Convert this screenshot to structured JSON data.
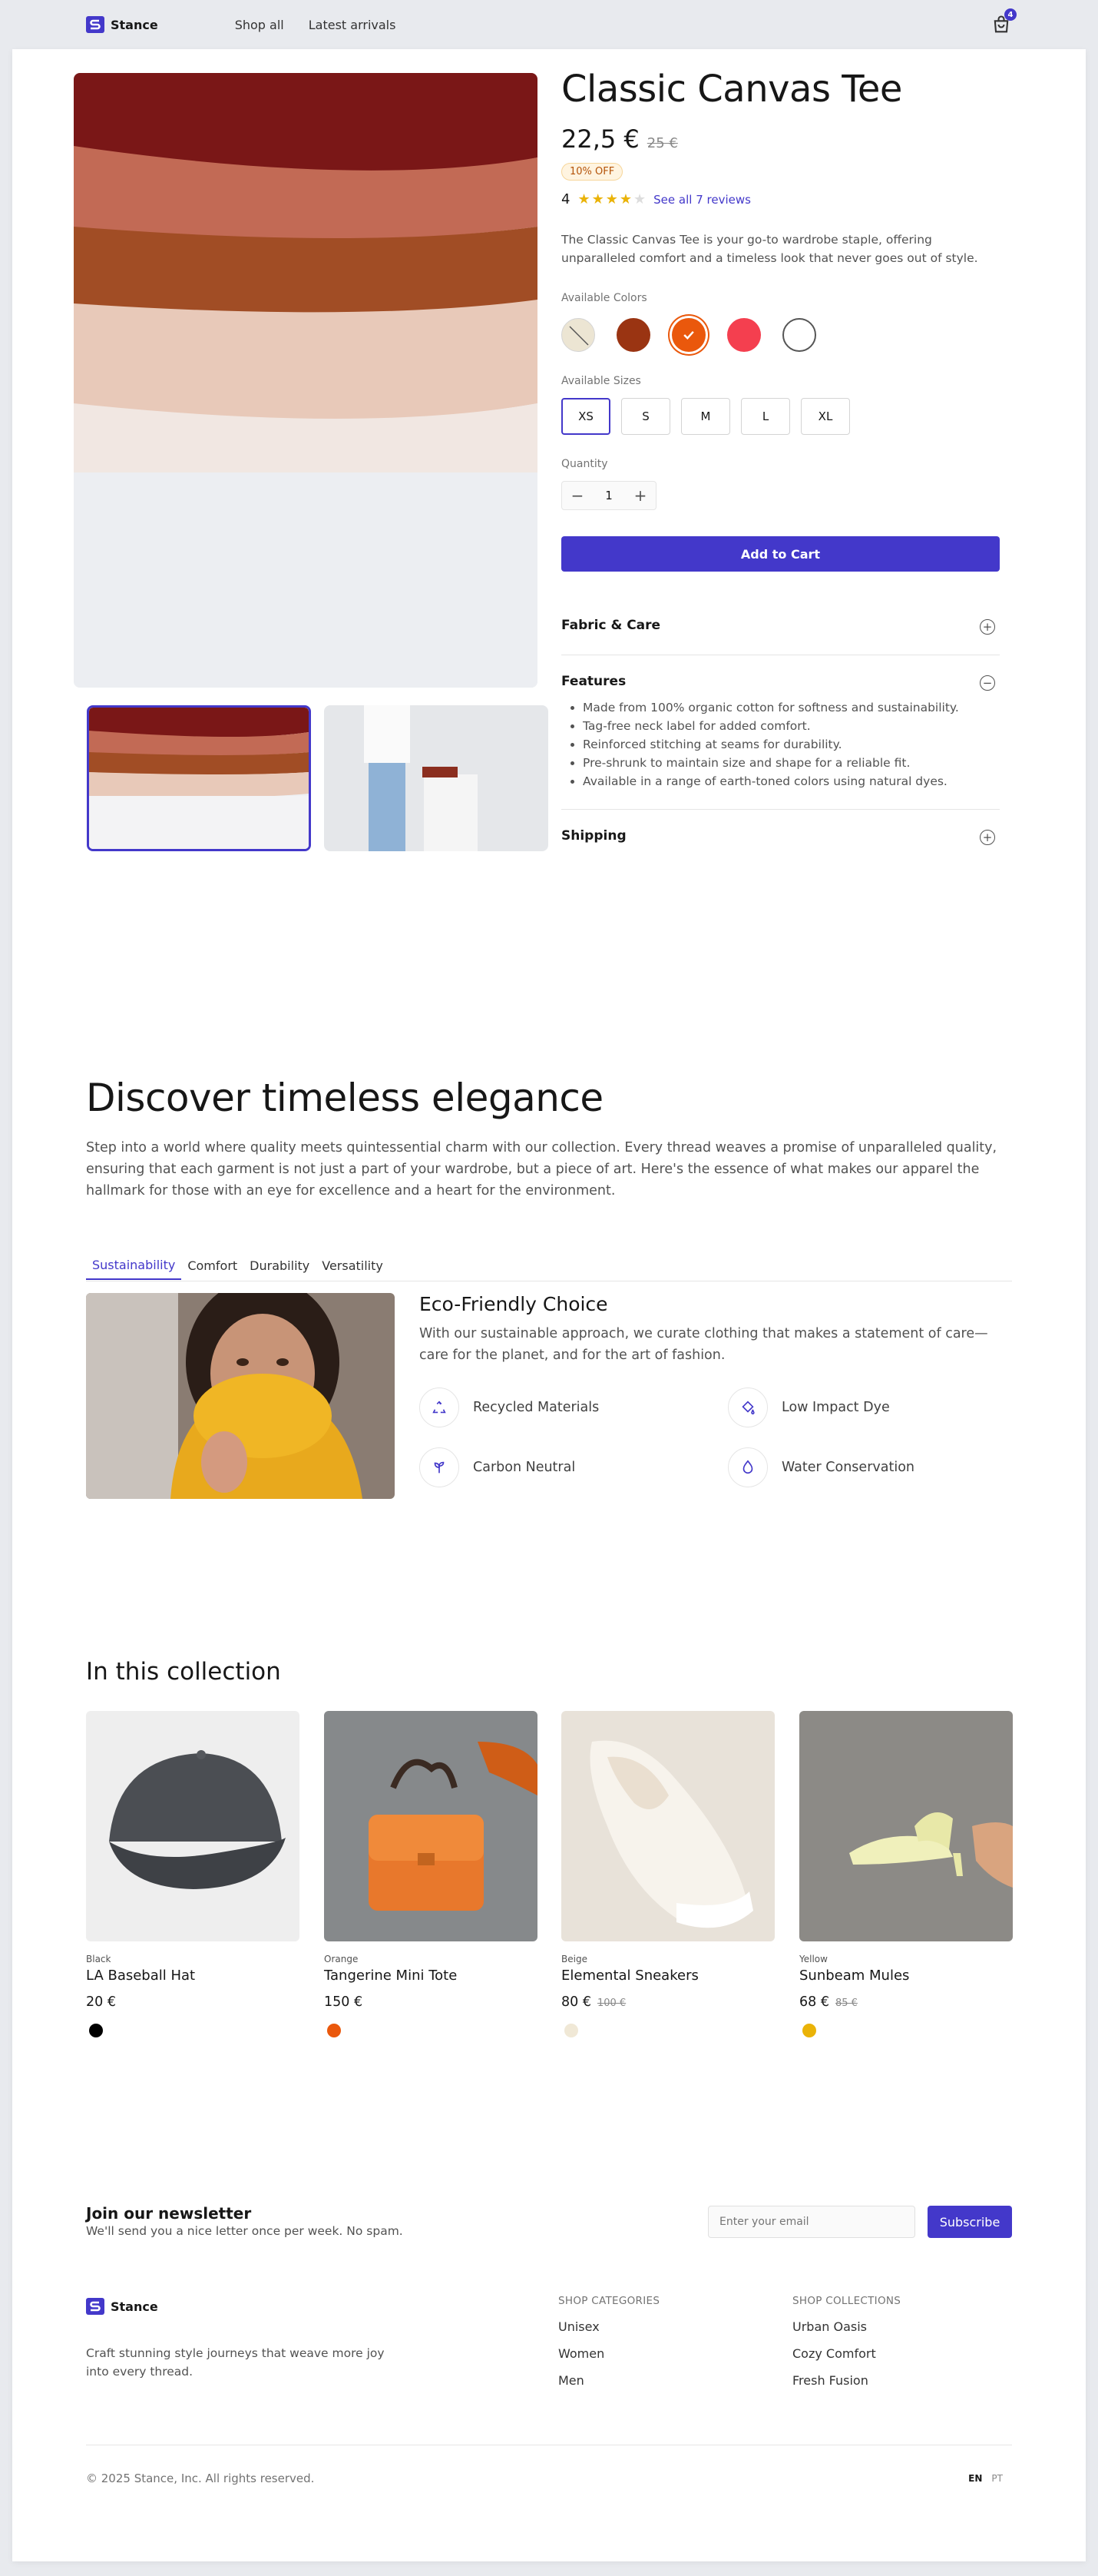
{
  "brand": {
    "name": "Stance",
    "color": "#4338ca"
  },
  "nav": {
    "items": [
      "Shop all",
      "Latest arrivals"
    ]
  },
  "cart": {
    "count": "4"
  },
  "product": {
    "title": "Classic Canvas Tee",
    "price": "22,5 €",
    "old_price": "25 €",
    "discount": "10% OFF",
    "rating": "4",
    "stars": 4,
    "reviews_link": "See all 7 reviews",
    "description": "The Classic Canvas Tee is your go-to wardrobe staple, offering unparalleled comfort and a timeless look that never goes out of style.",
    "colors_label": "Available Colors",
    "colors": [
      {
        "name": "beige",
        "hex": "#ece5d3",
        "state": "unavailable"
      },
      {
        "name": "brown",
        "hex": "#9a3412",
        "state": "normal"
      },
      {
        "name": "orange",
        "hex": "#ea580c",
        "state": "selected"
      },
      {
        "name": "red",
        "hex": "#f43f4f",
        "state": "normal"
      },
      {
        "name": "white",
        "hex": "#ffffff",
        "state": "normal"
      }
    ],
    "sizes_label": "Available Sizes",
    "sizes": [
      "XS",
      "S",
      "M",
      "L",
      "XL"
    ],
    "selected_size": "XS",
    "quantity_label": "Quantity",
    "quantity": "1",
    "add_to_cart": "Add to Cart",
    "accordion": [
      {
        "title": "Fabric & Care",
        "open": false
      },
      {
        "title": "Features",
        "open": true,
        "items": [
          "Made from 100% organic cotton for softness and sustainability.",
          "Tag-free neck label for added comfort.",
          "Reinforced stitching at seams for durability.",
          "Pre-shrunk to maintain size and shape for a reliable fit.",
          "Available in a range of earth-toned colors using natural dyes."
        ]
      },
      {
        "title": "Shipping",
        "open": false
      }
    ]
  },
  "discover": {
    "title": "Discover timeless elegance",
    "text": "Step into a world where quality meets quintessential charm with our collection. Every thread weaves a promise of unparalleled quality, ensuring that each garment is not just a part of your wardrobe, but a piece of art. Here's the essence of what makes our apparel the hallmark for those with an eye for excellence and a heart for the environment.",
    "tabs": [
      "Sustainability",
      "Comfort",
      "Durability",
      "Versatility"
    ],
    "active_tab": "Sustainability",
    "panel": {
      "title": "Eco-Friendly Choice",
      "text": "With our sustainable approach, we curate clothing that makes a statement of care—care for the planet, and for the art of fashion.",
      "features": [
        {
          "label": "Recycled Materials",
          "icon": "recycle-icon"
        },
        {
          "label": "Low Impact Dye",
          "icon": "paint-bucket-icon"
        },
        {
          "label": "Carbon Neutral",
          "icon": "sprout-icon"
        },
        {
          "label": "Water Conservation",
          "icon": "water-drop-icon"
        }
      ]
    }
  },
  "collection": {
    "title": "In this collection",
    "items": [
      {
        "color": "Black",
        "name": "LA Baseball Hat",
        "price": "20 €",
        "old_price": "",
        "dot": "#000000"
      },
      {
        "color": "Orange",
        "name": "Tangerine Mini Tote",
        "price": "150 €",
        "old_price": "",
        "dot": "#ea580c"
      },
      {
        "color": "Beige",
        "name": "Elemental Sneakers",
        "price": "80 €",
        "old_price": "100 €",
        "dot": "#f0e8d6"
      },
      {
        "color": "Yellow",
        "name": "Sunbeam Mules",
        "price": "68 €",
        "old_price": "85 €",
        "dot": "#eab308"
      }
    ]
  },
  "newsletter": {
    "title": "Join our newsletter",
    "subtitle": "We'll send you a nice letter once per week. No spam.",
    "placeholder": "Enter your email",
    "button": "Subscribe"
  },
  "footer": {
    "tagline": "Craft stunning style journeys that weave more joy into every thread.",
    "categories_heading": "SHOP CATEGORIES",
    "categories": [
      "Unisex",
      "Women",
      "Men"
    ],
    "collections_heading": "SHOP COLLECTIONS",
    "collections": [
      "Urban Oasis",
      "Cozy Comfort",
      "Fresh Fusion"
    ],
    "copyright": "© 2025 Stance, Inc. All rights reserved.",
    "languages": [
      "EN",
      "PT"
    ],
    "active_language": "EN"
  }
}
